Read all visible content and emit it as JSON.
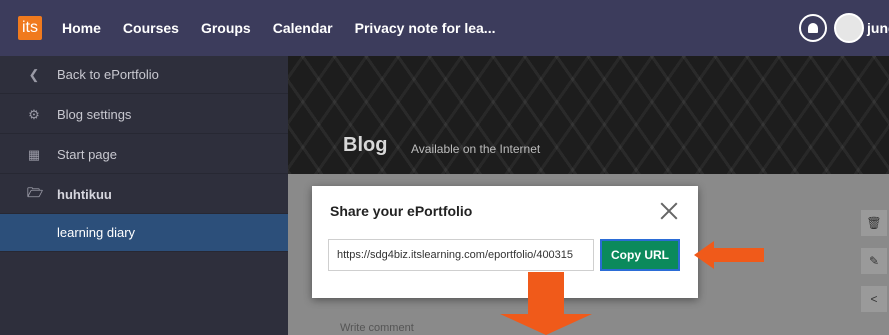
{
  "topbar": {
    "logo": "its",
    "nav": [
      "Home",
      "Courses",
      "Groups",
      "Calendar",
      "Privacy note for lea..."
    ],
    "user_name": "jung"
  },
  "sidebar": {
    "items": [
      {
        "label": "Back to ePortfolio",
        "icon": "chevron-left-icon"
      },
      {
        "label": "Blog settings",
        "icon": "gear-icon"
      },
      {
        "label": "Start page",
        "icon": "book-icon"
      },
      {
        "label": "huhtikuu",
        "icon": "folder-open-icon"
      },
      {
        "label": "learning diary",
        "icon": "none"
      }
    ]
  },
  "banner": {
    "title": "Blog",
    "subtitle": "Available on the Internet"
  },
  "content": {
    "comment_placeholder": "Write comment"
  },
  "dialog": {
    "title": "Share your ePortfolio",
    "url": "https://sdg4biz.itslearning.com/eportfolio/400315",
    "copy_label": "Copy URL"
  },
  "colors": {
    "topbar": "#3c3c5c",
    "sidebar": "#2e2f3c",
    "active_item": "#2c4f7a",
    "copy_button": "#0b8a5c",
    "arrow": "#f05a1a"
  }
}
